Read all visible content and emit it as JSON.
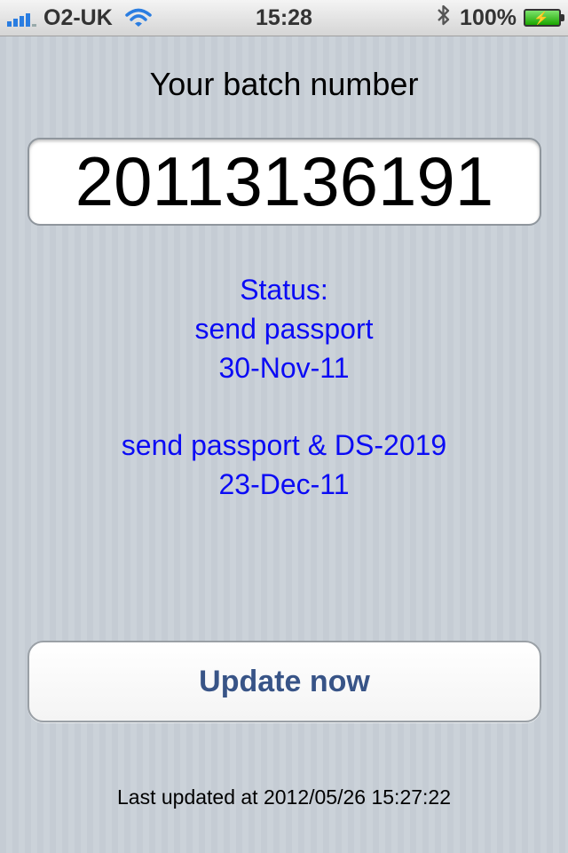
{
  "statusbar": {
    "carrier": "O2-UK",
    "time": "15:28",
    "battery_percent": "100%",
    "signal_bars": 4,
    "icons": [
      "signal-icon",
      "wifi-icon",
      "bluetooth-icon",
      "battery-charging-icon"
    ]
  },
  "main": {
    "heading": "Your batch number",
    "batch_number": "20113136191",
    "status": {
      "label": "Status:",
      "entries": [
        {
          "text": "send passport",
          "date": "30-Nov-11"
        },
        {
          "text": "send passport & DS-2019",
          "date": "23-Dec-11"
        }
      ]
    },
    "update_button_label": "Update now",
    "last_updated": "Last updated at 2012/05/26 15:27:22"
  },
  "colors": {
    "status_text": "#0b0bf5",
    "button_text": "#385487",
    "background": "#c5ccd4"
  }
}
